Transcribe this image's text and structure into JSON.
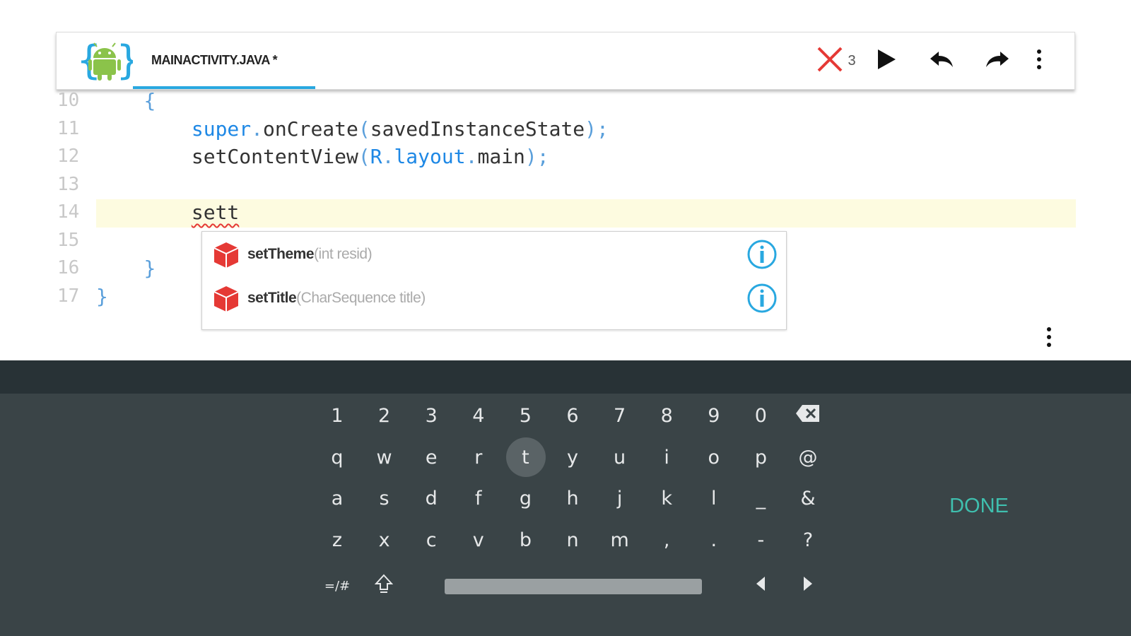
{
  "toolbar": {
    "file_tab_label": "MAINACTIVITY.JAVA *",
    "error_count": "3",
    "icons": {
      "logo": "android-logo-icon",
      "errors": "error-x-icon",
      "run": "play-icon",
      "undo": "undo-icon",
      "redo": "redo-icon",
      "menu": "more-vert-icon"
    }
  },
  "editor": {
    "lines": [
      {
        "number": "10",
        "indent": "    ",
        "parts": [
          {
            "t": "{",
            "c": "pn"
          }
        ]
      },
      {
        "number": "11",
        "indent": "        ",
        "parts": [
          {
            "t": "super",
            "c": "kw"
          },
          {
            "t": ".",
            "c": "pn"
          },
          {
            "t": "onCreate",
            "c": ""
          },
          {
            "t": "(",
            "c": "pn"
          },
          {
            "t": "savedInstanceState",
            "c": ""
          },
          {
            "t": ");",
            "c": "pn"
          }
        ]
      },
      {
        "number": "12",
        "indent": "        ",
        "parts": [
          {
            "t": "setContentView",
            "c": ""
          },
          {
            "t": "(",
            "c": "pn"
          },
          {
            "t": "R",
            "c": "kw"
          },
          {
            "t": ".",
            "c": "pn"
          },
          {
            "t": "layout",
            "c": "kw"
          },
          {
            "t": ".",
            "c": "pn"
          },
          {
            "t": "main",
            "c": ""
          },
          {
            "t": ");",
            "c": "pn"
          }
        ]
      },
      {
        "number": "13",
        "indent": "",
        "parts": []
      },
      {
        "number": "14",
        "indent": "        ",
        "parts": [
          {
            "t": "sett",
            "c": "squiggle"
          }
        ]
      },
      {
        "number": "15",
        "indent": "",
        "parts": []
      },
      {
        "number": "16",
        "indent": "    ",
        "parts": [
          {
            "t": "}",
            "c": "pn"
          }
        ]
      },
      {
        "number": "17",
        "indent": "",
        "parts": [
          {
            "t": "}",
            "c": "pn"
          }
        ]
      }
    ],
    "current_line": "14"
  },
  "autocomplete": {
    "items": [
      {
        "name": "setTheme",
        "signature": "(int resid)",
        "icon": "method-cube-icon",
        "info_icon": "info-icon"
      },
      {
        "name": "setTitle",
        "signature": "(CharSequence title)",
        "icon": "method-cube-icon",
        "info_icon": "info-icon"
      }
    ]
  },
  "keyboard": {
    "rows": [
      [
        "1",
        "2",
        "3",
        "4",
        "5",
        "6",
        "7",
        "8",
        "9",
        "0"
      ],
      [
        "q",
        "w",
        "e",
        "r",
        "t",
        "y",
        "u",
        "i",
        "o",
        "p",
        "@"
      ],
      [
        "a",
        "s",
        "d",
        "f",
        "g",
        "h",
        "j",
        "k",
        "l",
        "_",
        "&"
      ],
      [
        "z",
        "x",
        "c",
        "v",
        "b",
        "n",
        "m",
        ",",
        ".",
        "-",
        "?"
      ]
    ],
    "pressed_key": "t",
    "symbols_key": "=/#",
    "done_label": "DONE",
    "accent_color": "#3fbfae",
    "icons": {
      "backspace": "backspace-icon",
      "shift": "shift-icon",
      "left": "arrow-left-icon",
      "right": "arrow-right-icon"
    }
  },
  "colors": {
    "keyword": "#1e88e5",
    "tab_underline": "#29a8e0",
    "error": "#e53935",
    "keyboard_bg": "#3a4447"
  }
}
